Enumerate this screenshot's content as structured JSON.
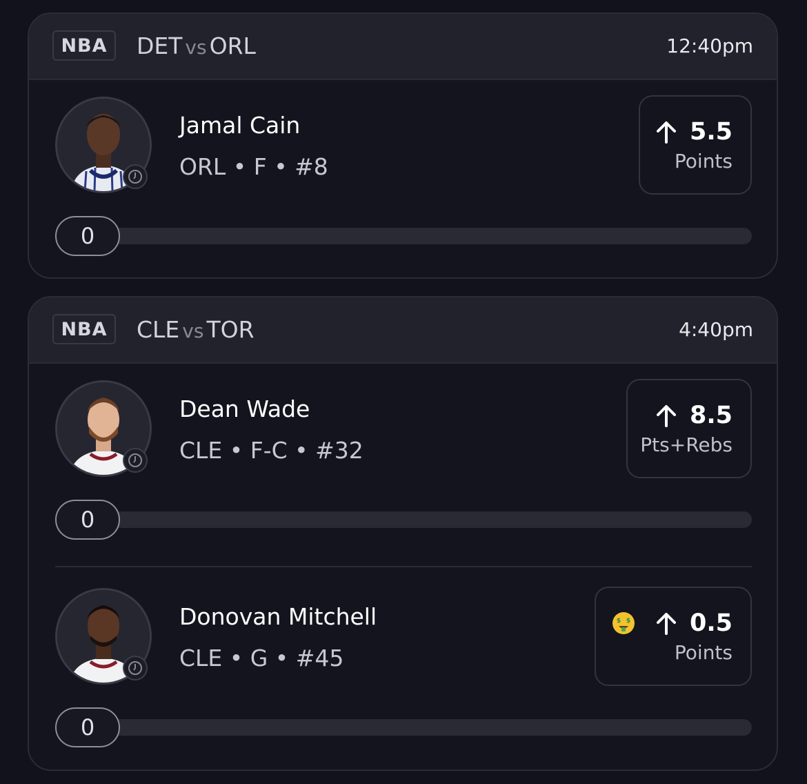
{
  "games": [
    {
      "league": "NBA",
      "team_a": "DET",
      "vs": "vs",
      "team_b": "ORL",
      "time": "12:40pm",
      "players": [
        {
          "name": "Jamal Cain",
          "meta": "ORL • F • #8",
          "prop_value": "5.5",
          "prop_stat": "Points",
          "direction_icon": "arrow-up-icon",
          "progress_value": "0",
          "progress_fraction": 0
        }
      ]
    },
    {
      "league": "NBA",
      "team_a": "CLE",
      "vs": "vs",
      "team_b": "TOR",
      "time": "4:40pm",
      "players": [
        {
          "name": "Dean Wade",
          "meta": "CLE • F-C • #32",
          "prop_value": "8.5",
          "prop_stat": "Pts+Rebs",
          "direction_icon": "arrow-up-icon",
          "progress_value": "0",
          "progress_fraction": 0
        },
        {
          "name": "Donovan Mitchell",
          "meta": "CLE • G • #45",
          "prop_value": "0.5",
          "prop_stat": "Points",
          "direction_icon": "arrow-up-icon",
          "badge_icon": "money-mouth-face-icon",
          "progress_value": "0",
          "progress_fraction": 0
        }
      ]
    }
  ],
  "colors": {
    "background": "#12121c",
    "header": "#22222c",
    "border": "#2c2c38",
    "track": "#2a2a34"
  }
}
